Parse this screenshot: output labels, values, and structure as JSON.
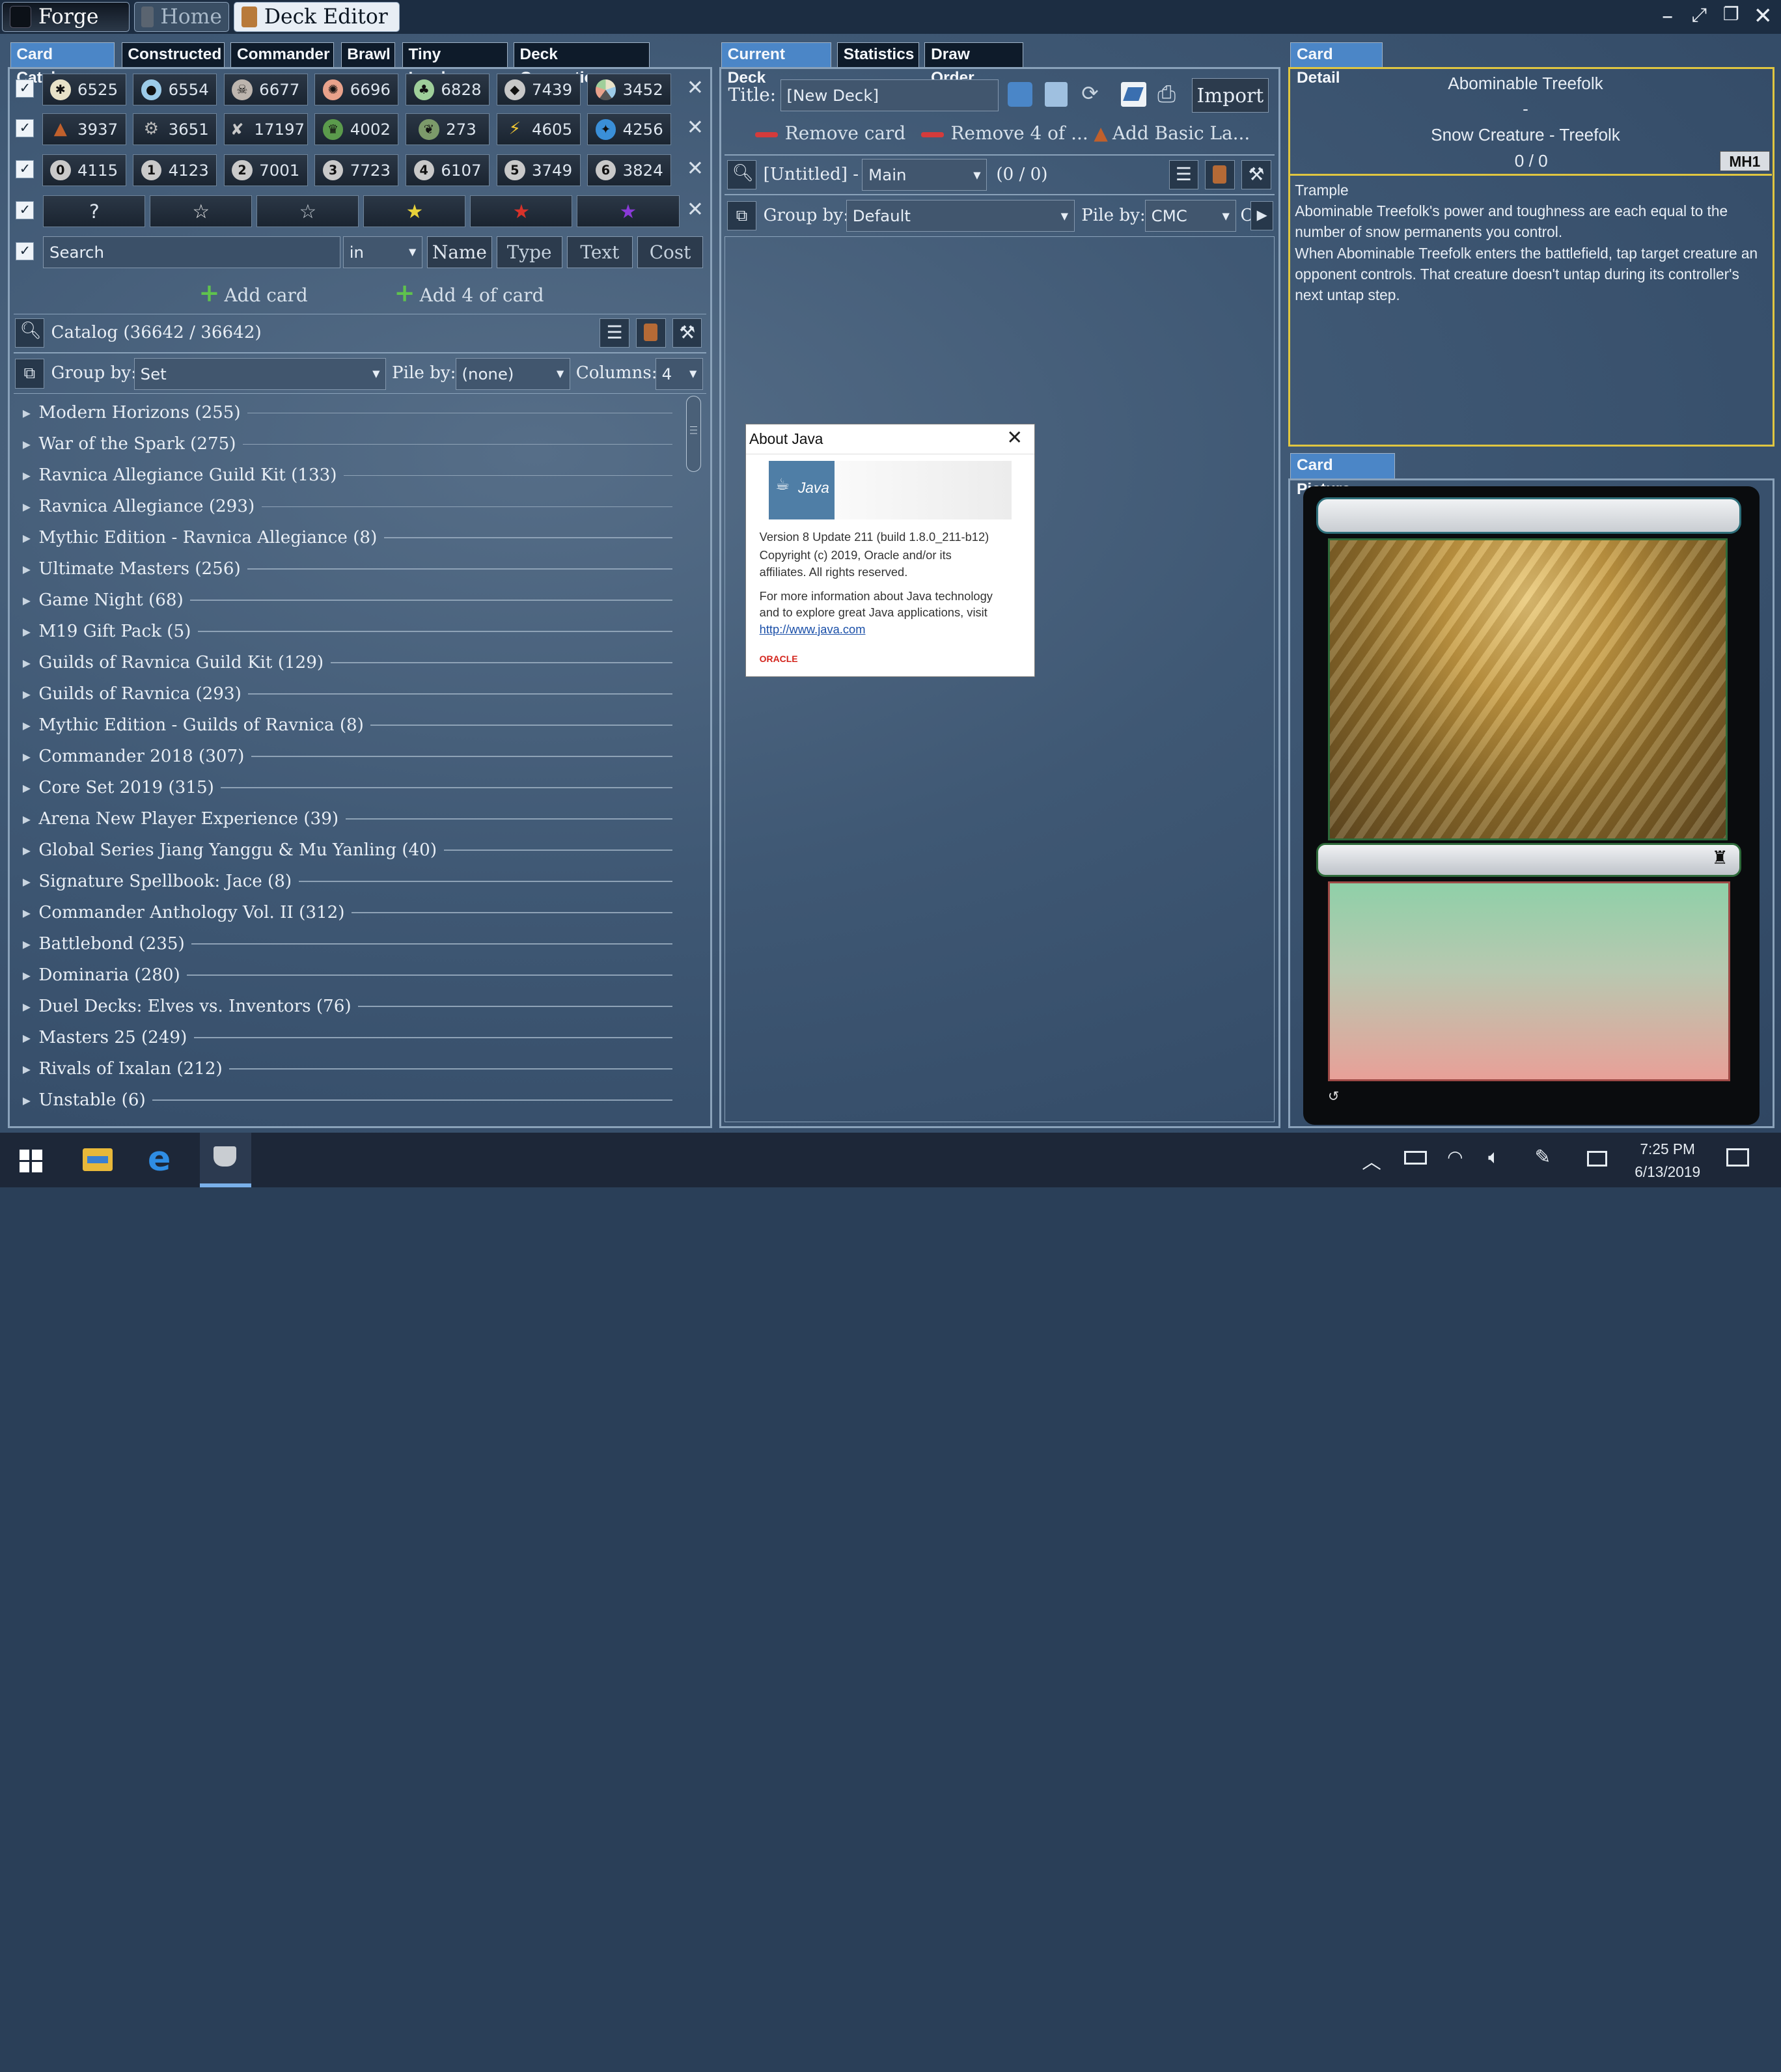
{
  "window": {
    "tabs": [
      {
        "label": "Forge"
      },
      {
        "label": "Home"
      },
      {
        "label": "Deck Editor"
      }
    ]
  },
  "catalog": {
    "tabs": [
      "Card Catalog",
      "Constructed",
      "Commander",
      "Brawl",
      "Tiny Leaders",
      "Deck Generation"
    ],
    "color_filters": [
      {
        "icon": "white-mana-icon",
        "value": "6525"
      },
      {
        "icon": "blue-mana-icon",
        "value": "6554"
      },
      {
        "icon": "black-mana-icon",
        "value": "6677"
      },
      {
        "icon": "red-mana-icon",
        "value": "6696"
      },
      {
        "icon": "green-mana-icon",
        "value": "6828"
      },
      {
        "icon": "colorless-icon",
        "value": "7439"
      },
      {
        "icon": "multicolor-icon",
        "value": "3452"
      }
    ],
    "type_filters": [
      {
        "icon": "land-icon",
        "value": "3937"
      },
      {
        "icon": "artifact-icon",
        "value": "3651"
      },
      {
        "icon": "creature-icon",
        "value": "17197"
      },
      {
        "icon": "enchantment-icon",
        "value": "4002"
      },
      {
        "icon": "planeswalker-icon",
        "value": "273"
      },
      {
        "icon": "instant-icon",
        "value": "4605"
      },
      {
        "icon": "sorcery-icon",
        "value": "4256"
      }
    ],
    "cmc_filters": [
      {
        "n": "0",
        "value": "4115"
      },
      {
        "n": "1",
        "value": "4123"
      },
      {
        "n": "2",
        "value": "7001"
      },
      {
        "n": "3",
        "value": "7723"
      },
      {
        "n": "4",
        "value": "6107"
      },
      {
        "n": "5",
        "value": "3749"
      },
      {
        "n": "6",
        "value": "3824"
      }
    ],
    "rarity_filters": [
      "?",
      "☆",
      "☆",
      "★",
      "★",
      "★"
    ],
    "search_placeholder": "Search",
    "search_mode": "in",
    "search_buttons": [
      "Name",
      "Type",
      "Text",
      "Cost"
    ],
    "add_card": "Add card",
    "add_4": "Add 4 of card",
    "count_label": "Catalog (36642 / 36642)",
    "group_by_label": "Group by:",
    "group_by": "Set",
    "pile_by_label": "Pile by:",
    "pile_by": "(none)",
    "columns_label": "Columns:",
    "columns": "4",
    "sets": [
      "Modern Horizons (255)",
      "War of the Spark (275)",
      "Ravnica Allegiance Guild Kit (133)",
      "Ravnica Allegiance (293)",
      "Mythic Edition - Ravnica Allegiance (8)",
      "Ultimate Masters (256)",
      "Game Night (68)",
      "M19 Gift Pack (5)",
      "Guilds of Ravnica Guild Kit (129)",
      "Guilds of Ravnica (293)",
      "Mythic Edition - Guilds of Ravnica (8)",
      "Commander 2018 (307)",
      "Core Set 2019 (315)",
      "Arena New Player Experience (39)",
      "Global Series Jiang Yanggu & Mu Yanling (40)",
      "Signature Spellbook: Jace (8)",
      "Commander Anthology Vol. II (312)",
      "Battlebond (235)",
      "Dominaria (280)",
      "Duel Decks: Elves vs. Inventors (76)",
      "Masters 25 (249)",
      "Rivals of Ixalan (212)",
      "Unstable (6)"
    ]
  },
  "deck": {
    "tabs": [
      "Current Deck",
      "Statistics",
      "Draw Order"
    ],
    "title_label": "Title:",
    "title_value": "[New Deck]",
    "import": "Import",
    "remove_card": "Remove card",
    "remove_4": "Remove 4 of ...",
    "add_basic": "Add Basic La...",
    "name": "[Untitled] -",
    "section": "Main",
    "count": "(0 / 0)",
    "group_by_label": "Group by:",
    "group_by": "Default",
    "pile_by_label": "Pile by:",
    "pile_by": "CMC",
    "truncated": "C"
  },
  "detail": {
    "tab": "Card Detail",
    "name": "Abominable Treefolk",
    "cost": "-",
    "type": "Snow Creature - Treefolk",
    "pt": "0 / 0",
    "set": "MH1",
    "rules": [
      "Trample",
      "Abominable Treefolk's power and toughness are each equal to the number of snow permanents you control.",
      "When Abominable Treefolk enters the battlefield, tap target creature an opponent controls. That creature doesn't untap during its controller's next untap step."
    ],
    "picture_tab": "Card Picture"
  },
  "about": {
    "title": "About Java",
    "logo": "Java",
    "version": "Version 8 Update 211  (build 1.8.0_211-b12)",
    "copyright": "Copyright (c) 2019, Oracle and/or its affiliates. All rights reserved.",
    "info": "For more information about Java technology and to explore great Java applications, visit",
    "link": "http://www.java.com",
    "oracle": "ORACLE"
  },
  "taskbar": {
    "time": "7:25 PM",
    "date": "6/13/2019"
  }
}
